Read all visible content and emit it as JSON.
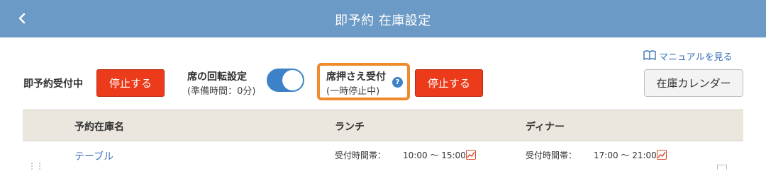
{
  "header": {
    "title": "即予約 在庫設定"
  },
  "manual_link": {
    "label": "マニュアルを見る"
  },
  "status": {
    "instant_label": "即予約受付中",
    "instant_button": "停止する",
    "rotation_label": "席の回転設定",
    "rotation_sub": "(準備時間：0分)",
    "rotation_on": true,
    "hold_label": "席押さえ受付",
    "hold_sub": "(一時停止中)",
    "hold_button": "停止する"
  },
  "calendar_button": "在庫カレンダー",
  "table": {
    "headers": {
      "name": "予約在庫名",
      "lunch": "ランチ",
      "dinner": "ディナー"
    },
    "rows": [
      {
        "name": "テーブル",
        "lunch": {
          "label": "受付時間帯：",
          "time": "10:00 〜 15:00"
        },
        "dinner": {
          "label": "受付時間帯：",
          "time": "17:00 〜 21:00"
        }
      }
    ]
  },
  "colors": {
    "header": "#6b9ac6",
    "accent": "#3d82c8",
    "stop": "#ec3b1a",
    "highlight": "#f08a2c"
  }
}
